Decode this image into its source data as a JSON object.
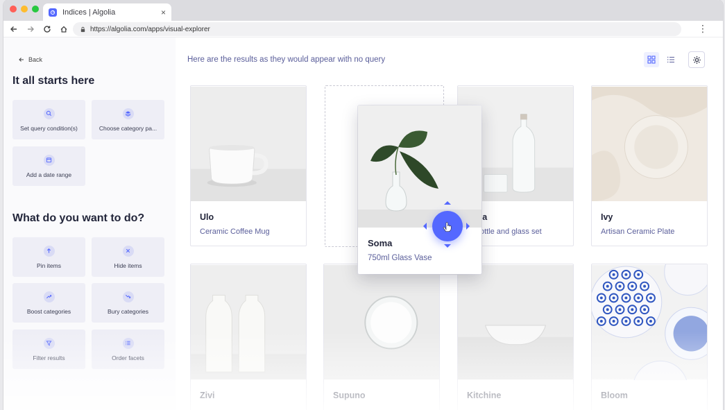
{
  "browser": {
    "tab_title": "Indices | Algolia",
    "tab_close": "×",
    "url": "https://algolia.com/apps/visual-explorer",
    "menu": "⋮"
  },
  "sidebar": {
    "back_label": "Back",
    "section1_title": "It all starts here",
    "section1_actions": [
      {
        "label": "Set query condition(s)",
        "icon": "search-icon"
      },
      {
        "label": "Choose category pa...",
        "icon": "layers-icon"
      },
      {
        "label": "Add a date range",
        "icon": "calendar-icon"
      }
    ],
    "section2_title": "What do you want to do?",
    "section2_actions": [
      {
        "label": "Pin items",
        "icon": "arrow-up-icon"
      },
      {
        "label": "Hide items",
        "icon": "close-icon"
      },
      {
        "label": "Boost categories",
        "icon": "trend-up-icon"
      },
      {
        "label": "Bury categories",
        "icon": "trend-down-icon"
      },
      {
        "label": "Filter results",
        "icon": "filter-icon"
      },
      {
        "label": "Order facets",
        "icon": "list-icon"
      }
    ]
  },
  "main": {
    "hint": "Here are the results as they would appear with no query",
    "view_grid_icon": "grid-icon",
    "view_list_icon": "list-icon",
    "settings_icon": "gear-icon",
    "products": [
      {
        "name": "Ulo",
        "desc": "Ceramic Coffee Mug"
      },
      {
        "name": "sona",
        "desc": "er bottle and glass set"
      },
      {
        "name": "Ivy",
        "desc": "Artisan Ceramic Plate"
      },
      {
        "name": "Zivi",
        "desc": ""
      },
      {
        "name": "Supuno",
        "desc": ""
      },
      {
        "name": "Kitchine",
        "desc": ""
      },
      {
        "name": "Bloom",
        "desc": ""
      }
    ],
    "dragged": {
      "name": "Soma",
      "desc": "750ml Glass Vase"
    }
  },
  "colors": {
    "accent": "#5468ff",
    "text_primary": "#23263b",
    "text_secondary": "#5a5e9a",
    "action_bg": "#eeeef6"
  }
}
